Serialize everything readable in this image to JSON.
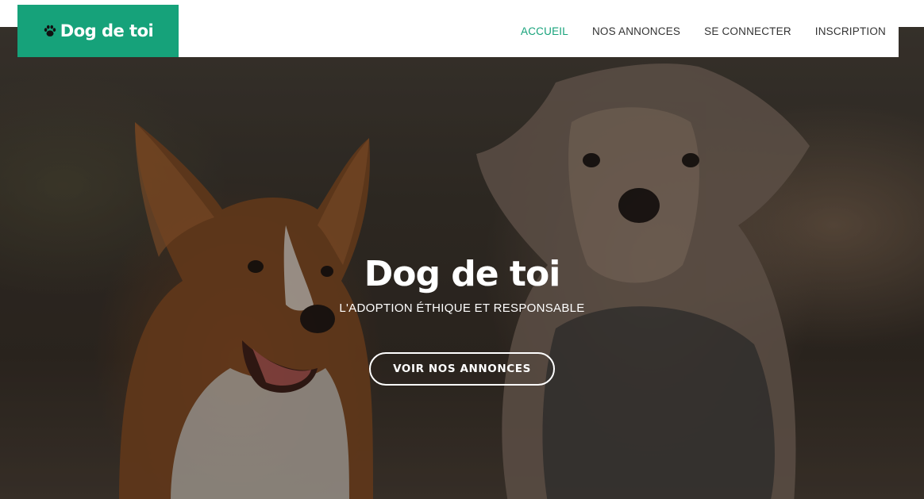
{
  "header": {
    "logo_icon": "paw-icon",
    "logo_text": "Dog de toi",
    "brand_color": "#16a27a",
    "nav": [
      {
        "label": "ACCUEIL",
        "active": true
      },
      {
        "label": "NOS ANNONCES",
        "active": false
      },
      {
        "label": "SE CONNECTER",
        "active": false
      },
      {
        "label": "INSCRIPTION",
        "active": false
      }
    ]
  },
  "hero": {
    "background": "photo of a corgi and a yorkshire terrier",
    "title": "Dog de toi",
    "subtitle": "L'ADOPTION ÉTHIQUE ET RESPONSABLE",
    "cta_label": "VOIR NOS ANNONCES"
  }
}
